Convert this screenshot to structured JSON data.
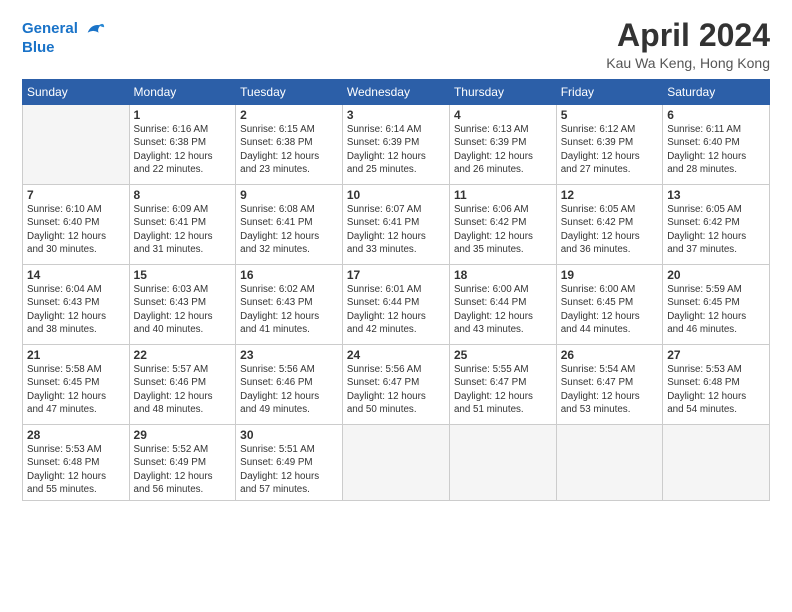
{
  "logo": {
    "line1": "General",
    "line2": "Blue"
  },
  "title": "April 2024",
  "location": "Kau Wa Keng, Hong Kong",
  "header": {
    "days": [
      "Sunday",
      "Monday",
      "Tuesday",
      "Wednesday",
      "Thursday",
      "Friday",
      "Saturday"
    ]
  },
  "weeks": [
    [
      {
        "day": "",
        "empty": true
      },
      {
        "day": "1",
        "rise": "6:16 AM",
        "set": "6:38 PM",
        "daylight": "12 hours and 22 minutes."
      },
      {
        "day": "2",
        "rise": "6:15 AM",
        "set": "6:38 PM",
        "daylight": "12 hours and 23 minutes."
      },
      {
        "day": "3",
        "rise": "6:14 AM",
        "set": "6:39 PM",
        "daylight": "12 hours and 25 minutes."
      },
      {
        "day": "4",
        "rise": "6:13 AM",
        "set": "6:39 PM",
        "daylight": "12 hours and 26 minutes."
      },
      {
        "day": "5",
        "rise": "6:12 AM",
        "set": "6:39 PM",
        "daylight": "12 hours and 27 minutes."
      },
      {
        "day": "6",
        "rise": "6:11 AM",
        "set": "6:40 PM",
        "daylight": "12 hours and 28 minutes."
      }
    ],
    [
      {
        "day": "7",
        "rise": "6:10 AM",
        "set": "6:40 PM",
        "daylight": "12 hours and 30 minutes."
      },
      {
        "day": "8",
        "rise": "6:09 AM",
        "set": "6:41 PM",
        "daylight": "12 hours and 31 minutes."
      },
      {
        "day": "9",
        "rise": "6:08 AM",
        "set": "6:41 PM",
        "daylight": "12 hours and 32 minutes."
      },
      {
        "day": "10",
        "rise": "6:07 AM",
        "set": "6:41 PM",
        "daylight": "12 hours and 33 minutes."
      },
      {
        "day": "11",
        "rise": "6:06 AM",
        "set": "6:42 PM",
        "daylight": "12 hours and 35 minutes."
      },
      {
        "day": "12",
        "rise": "6:05 AM",
        "set": "6:42 PM",
        "daylight": "12 hours and 36 minutes."
      },
      {
        "day": "13",
        "rise": "6:05 AM",
        "set": "6:42 PM",
        "daylight": "12 hours and 37 minutes."
      }
    ],
    [
      {
        "day": "14",
        "rise": "6:04 AM",
        "set": "6:43 PM",
        "daylight": "12 hours and 38 minutes."
      },
      {
        "day": "15",
        "rise": "6:03 AM",
        "set": "6:43 PM",
        "daylight": "12 hours and 40 minutes."
      },
      {
        "day": "16",
        "rise": "6:02 AM",
        "set": "6:43 PM",
        "daylight": "12 hours and 41 minutes."
      },
      {
        "day": "17",
        "rise": "6:01 AM",
        "set": "6:44 PM",
        "daylight": "12 hours and 42 minutes."
      },
      {
        "day": "18",
        "rise": "6:00 AM",
        "set": "6:44 PM",
        "daylight": "12 hours and 43 minutes."
      },
      {
        "day": "19",
        "rise": "6:00 AM",
        "set": "6:45 PM",
        "daylight": "12 hours and 44 minutes."
      },
      {
        "day": "20",
        "rise": "5:59 AM",
        "set": "6:45 PM",
        "daylight": "12 hours and 46 minutes."
      }
    ],
    [
      {
        "day": "21",
        "rise": "5:58 AM",
        "set": "6:45 PM",
        "daylight": "12 hours and 47 minutes."
      },
      {
        "day": "22",
        "rise": "5:57 AM",
        "set": "6:46 PM",
        "daylight": "12 hours and 48 minutes."
      },
      {
        "day": "23",
        "rise": "5:56 AM",
        "set": "6:46 PM",
        "daylight": "12 hours and 49 minutes."
      },
      {
        "day": "24",
        "rise": "5:56 AM",
        "set": "6:47 PM",
        "daylight": "12 hours and 50 minutes."
      },
      {
        "day": "25",
        "rise": "5:55 AM",
        "set": "6:47 PM",
        "daylight": "12 hours and 51 minutes."
      },
      {
        "day": "26",
        "rise": "5:54 AM",
        "set": "6:47 PM",
        "daylight": "12 hours and 53 minutes."
      },
      {
        "day": "27",
        "rise": "5:53 AM",
        "set": "6:48 PM",
        "daylight": "12 hours and 54 minutes."
      }
    ],
    [
      {
        "day": "28",
        "rise": "5:53 AM",
        "set": "6:48 PM",
        "daylight": "12 hours and 55 minutes."
      },
      {
        "day": "29",
        "rise": "5:52 AM",
        "set": "6:49 PM",
        "daylight": "12 hours and 56 minutes."
      },
      {
        "day": "30",
        "rise": "5:51 AM",
        "set": "6:49 PM",
        "daylight": "12 hours and 57 minutes."
      },
      {
        "day": "",
        "empty": true
      },
      {
        "day": "",
        "empty": true
      },
      {
        "day": "",
        "empty": true
      },
      {
        "day": "",
        "empty": true
      }
    ]
  ]
}
